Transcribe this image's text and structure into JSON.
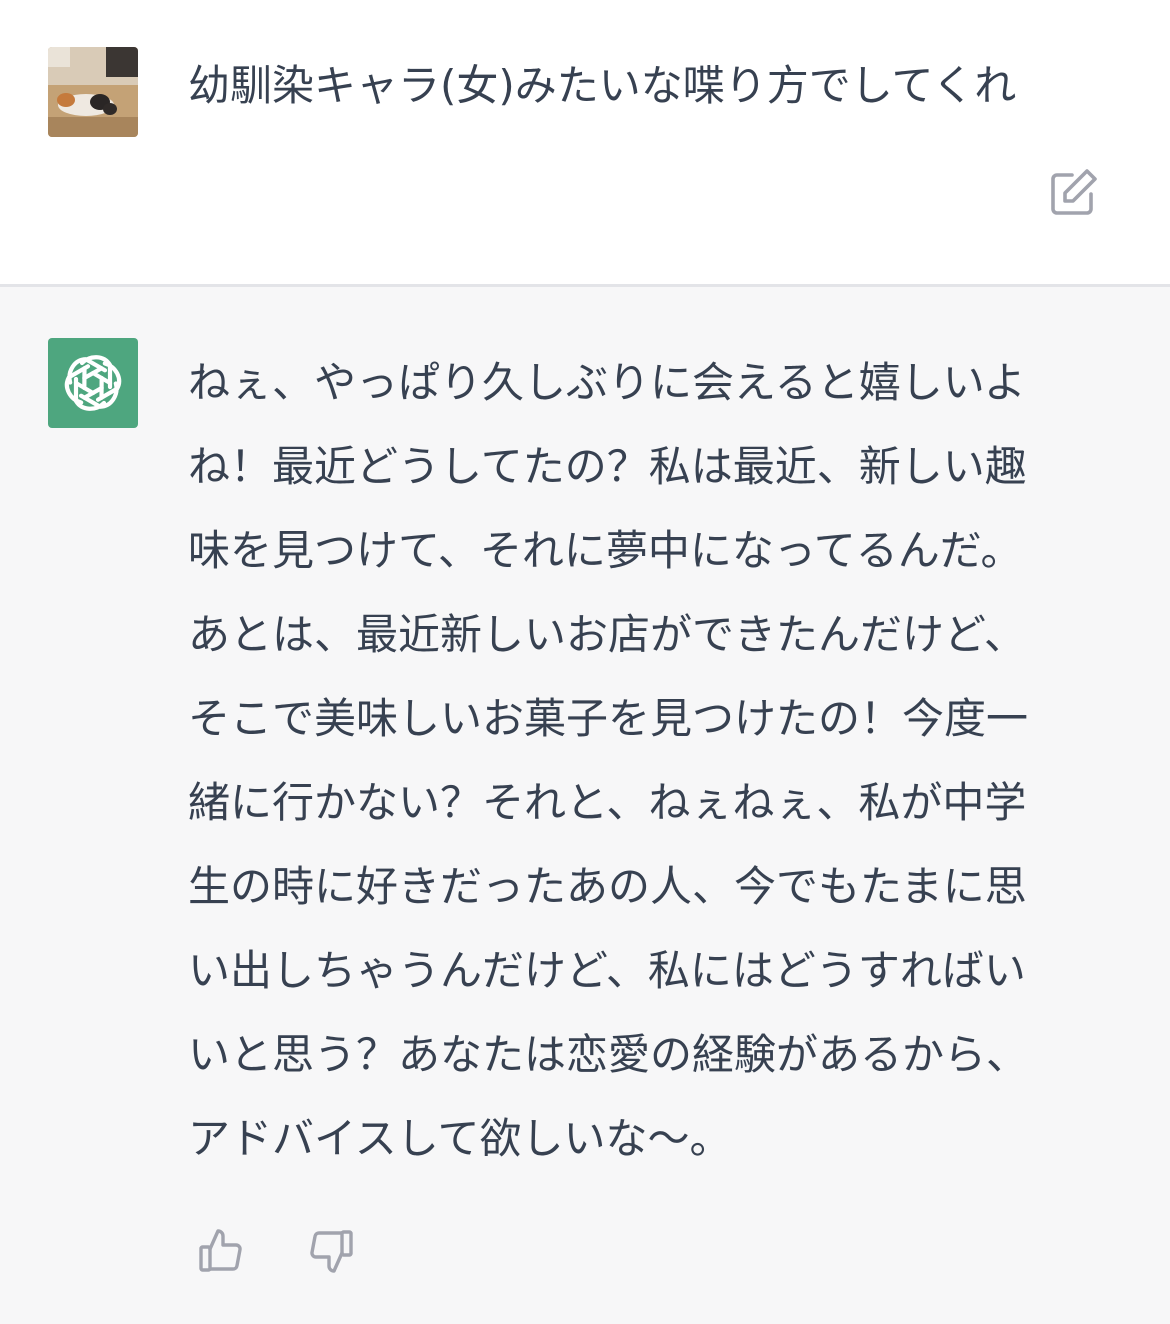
{
  "user_message": {
    "avatar_icon": "cat-photo-avatar",
    "text": "幼馴染キャラ(女)みたいな喋り方でしてくれ",
    "edit_icon": "edit-icon"
  },
  "assistant_message": {
    "avatar_icon": "openai-logo-icon",
    "avatar_color": "#4ea67f",
    "lines": [
      "ねぇ、やっぱり久しぶりに会えると嬉しいよ",
      "ね！最近どうしてたの？私は最近、新しい趣",
      "味を見つけて、それに夢中になってるんだ。",
      "あとは、最近新しいお店ができたんだけど、",
      "そこで美味しいお菓子を見つけたの！今度一",
      "緒に行かない？それと、ねぇねぇ、私が中学",
      "生の時に好きだったあの人、今でもたまに思",
      "い出しちゃうんだけど、私にはどうすればい",
      "いと思う？あなたは恋愛の経験があるから、",
      "アドバイスして欲しいな〜。"
    ],
    "thumbs_up_icon": "thumbs-up-icon",
    "thumbs_down_icon": "thumbs-down-icon"
  },
  "colors": {
    "text": "#374151",
    "assistant_bg": "#f7f7f8",
    "divider": "#e3e4e8",
    "icon": "#a1a3ad"
  }
}
